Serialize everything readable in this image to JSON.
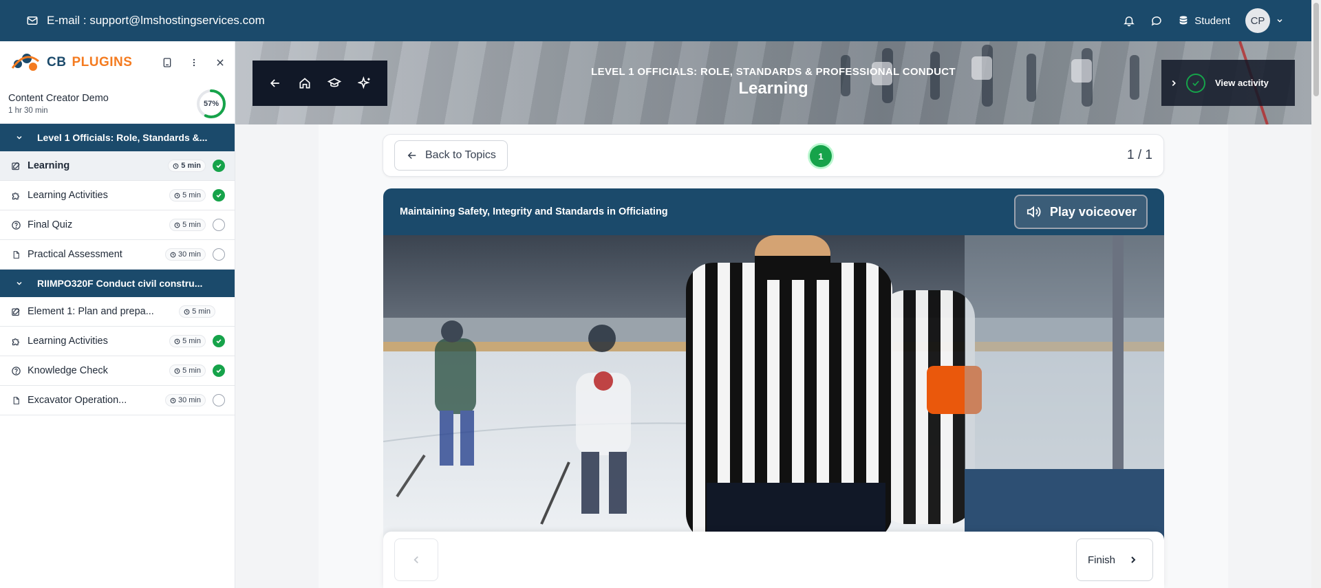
{
  "topbar": {
    "email": "E-mail : support@lmshostingservices.com",
    "role": "Student",
    "avatar_initials": "CP"
  },
  "brand": {
    "logo_cb": "CB",
    "logo_plugins": "PLUGINS",
    "primary_color": "#1b4a6b",
    "accent_color": "#f47b20",
    "success_color": "#16a34a"
  },
  "sidebar": {
    "course_name": "Content Creator Demo",
    "course_duration": "1 hr 30 min",
    "progress_label": "57%",
    "progress": 0.57,
    "sections": [
      {
        "title": "Level 1 Officials: Role, Standards &...",
        "items": [
          {
            "label": "Learning",
            "icon": "edit-icon",
            "time": "5 min",
            "status": "done",
            "active": true
          },
          {
            "label": "Learning Activities",
            "icon": "puzzle-icon",
            "time": "5 min",
            "status": "done"
          },
          {
            "label": "Final Quiz",
            "icon": "question-icon",
            "time": "5 min",
            "status": "todo"
          },
          {
            "label": "Practical Assessment",
            "icon": "document-icon",
            "time": "30 min",
            "status": "todo"
          }
        ]
      },
      {
        "title": "RIIMPO320F Conduct civil constru...",
        "items": [
          {
            "label": "Element 1: Plan and prepa...",
            "icon": "edit-icon",
            "time": "5 min",
            "status": "none"
          },
          {
            "label": "Learning Activities",
            "icon": "puzzle-icon",
            "time": "5 min",
            "status": "done"
          },
          {
            "label": "Knowledge Check",
            "icon": "question-icon",
            "time": "5 min",
            "status": "done"
          },
          {
            "label": "Excavator Operation...",
            "icon": "document-icon",
            "time": "30 min",
            "status": "todo"
          }
        ]
      }
    ]
  },
  "hero": {
    "subtitle": "LEVEL 1 OFFICIALS: ROLE, STANDARDS & PROFESSIONAL CONDUCT",
    "title": "Learning",
    "view_activity": "View activity"
  },
  "topic_bar": {
    "back_label": "Back to Topics",
    "current_step": "1",
    "counter": "1 / 1"
  },
  "card": {
    "title": "Maintaining Safety, Integrity and Standards in Officiating",
    "voiceover_label": "Play voiceover"
  },
  "footer": {
    "finish_label": "Finish"
  }
}
